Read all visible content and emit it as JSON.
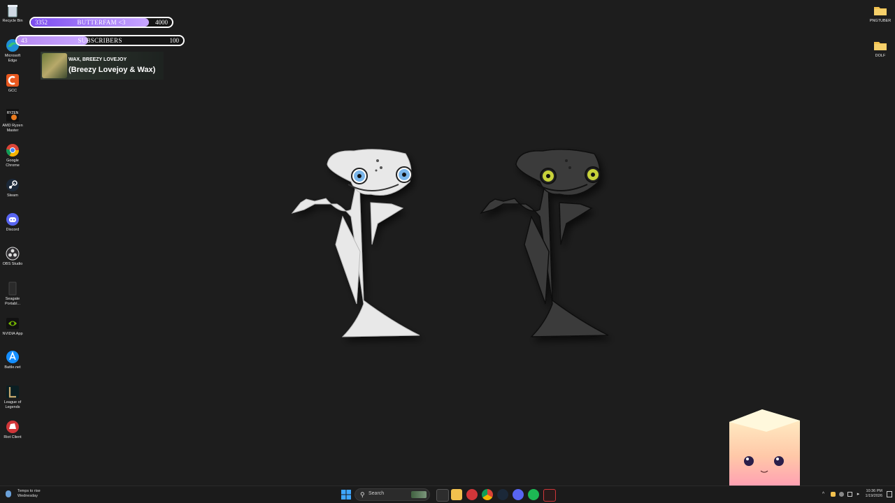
{
  "desktop_left_icons": [
    {
      "label": "Recycle Bin",
      "icon": "recycle-bin-icon"
    },
    {
      "label": "Microsoft Edge",
      "icon": "edge-icon"
    },
    {
      "label": "GCC",
      "icon": "gcc-icon"
    },
    {
      "label": "AMD Ryzen Master",
      "icon": "amd-ryzen-icon"
    },
    {
      "label": "Google Chrome",
      "icon": "chrome-icon"
    },
    {
      "label": "Steam",
      "icon": "steam-icon"
    },
    {
      "label": "Discord",
      "icon": "discord-icon"
    },
    {
      "label": "OBS Studio",
      "icon": "obs-icon"
    },
    {
      "label": "Seagate Portabl...",
      "icon": "seagate-icon"
    },
    {
      "label": "NVIDIA App",
      "icon": "nvidia-icon"
    },
    {
      "label": "Battle.net",
      "icon": "battlenet-icon"
    },
    {
      "label": "League of Legends",
      "icon": "league-icon"
    },
    {
      "label": "Riot Client",
      "icon": "riot-icon"
    }
  ],
  "desktop_right_icons": [
    {
      "label": "PNGTUBER",
      "icon": "folder-icon"
    },
    {
      "label": "DOLF",
      "icon": "folder-icon"
    }
  ],
  "goal_bar_1": {
    "current": "3352",
    "title": "BUTTERFAM <3",
    "target": "4000",
    "progress": 0.838,
    "color": "#7b4cf0"
  },
  "goal_bar_2": {
    "current": "43",
    "title": "SUBSCRIBERS",
    "target": "100",
    "progress": 0.43,
    "color": "#b78af2"
  },
  "now_playing": {
    "artist": "WAX, BREEZY LOVEJOY",
    "track": "(Breezy Lovejoy & Wax)"
  },
  "taskbar": {
    "weather_line1": "Temps to rise",
    "weather_line2": "Wednesday",
    "search_placeholder": "Search",
    "time": "10:36 PM",
    "date": "1/19/2026"
  },
  "characters": [
    {
      "name": "white creature",
      "body_color": "#e8e8e8",
      "eye_color": "#7ab6ea"
    },
    {
      "name": "black creature",
      "body_color": "#3a3a3a",
      "eye_color": "#c8d23a"
    }
  ],
  "colors": {
    "desktop_bg": "#1d1d1d",
    "taskbar_bg": "#1b1b1b"
  }
}
